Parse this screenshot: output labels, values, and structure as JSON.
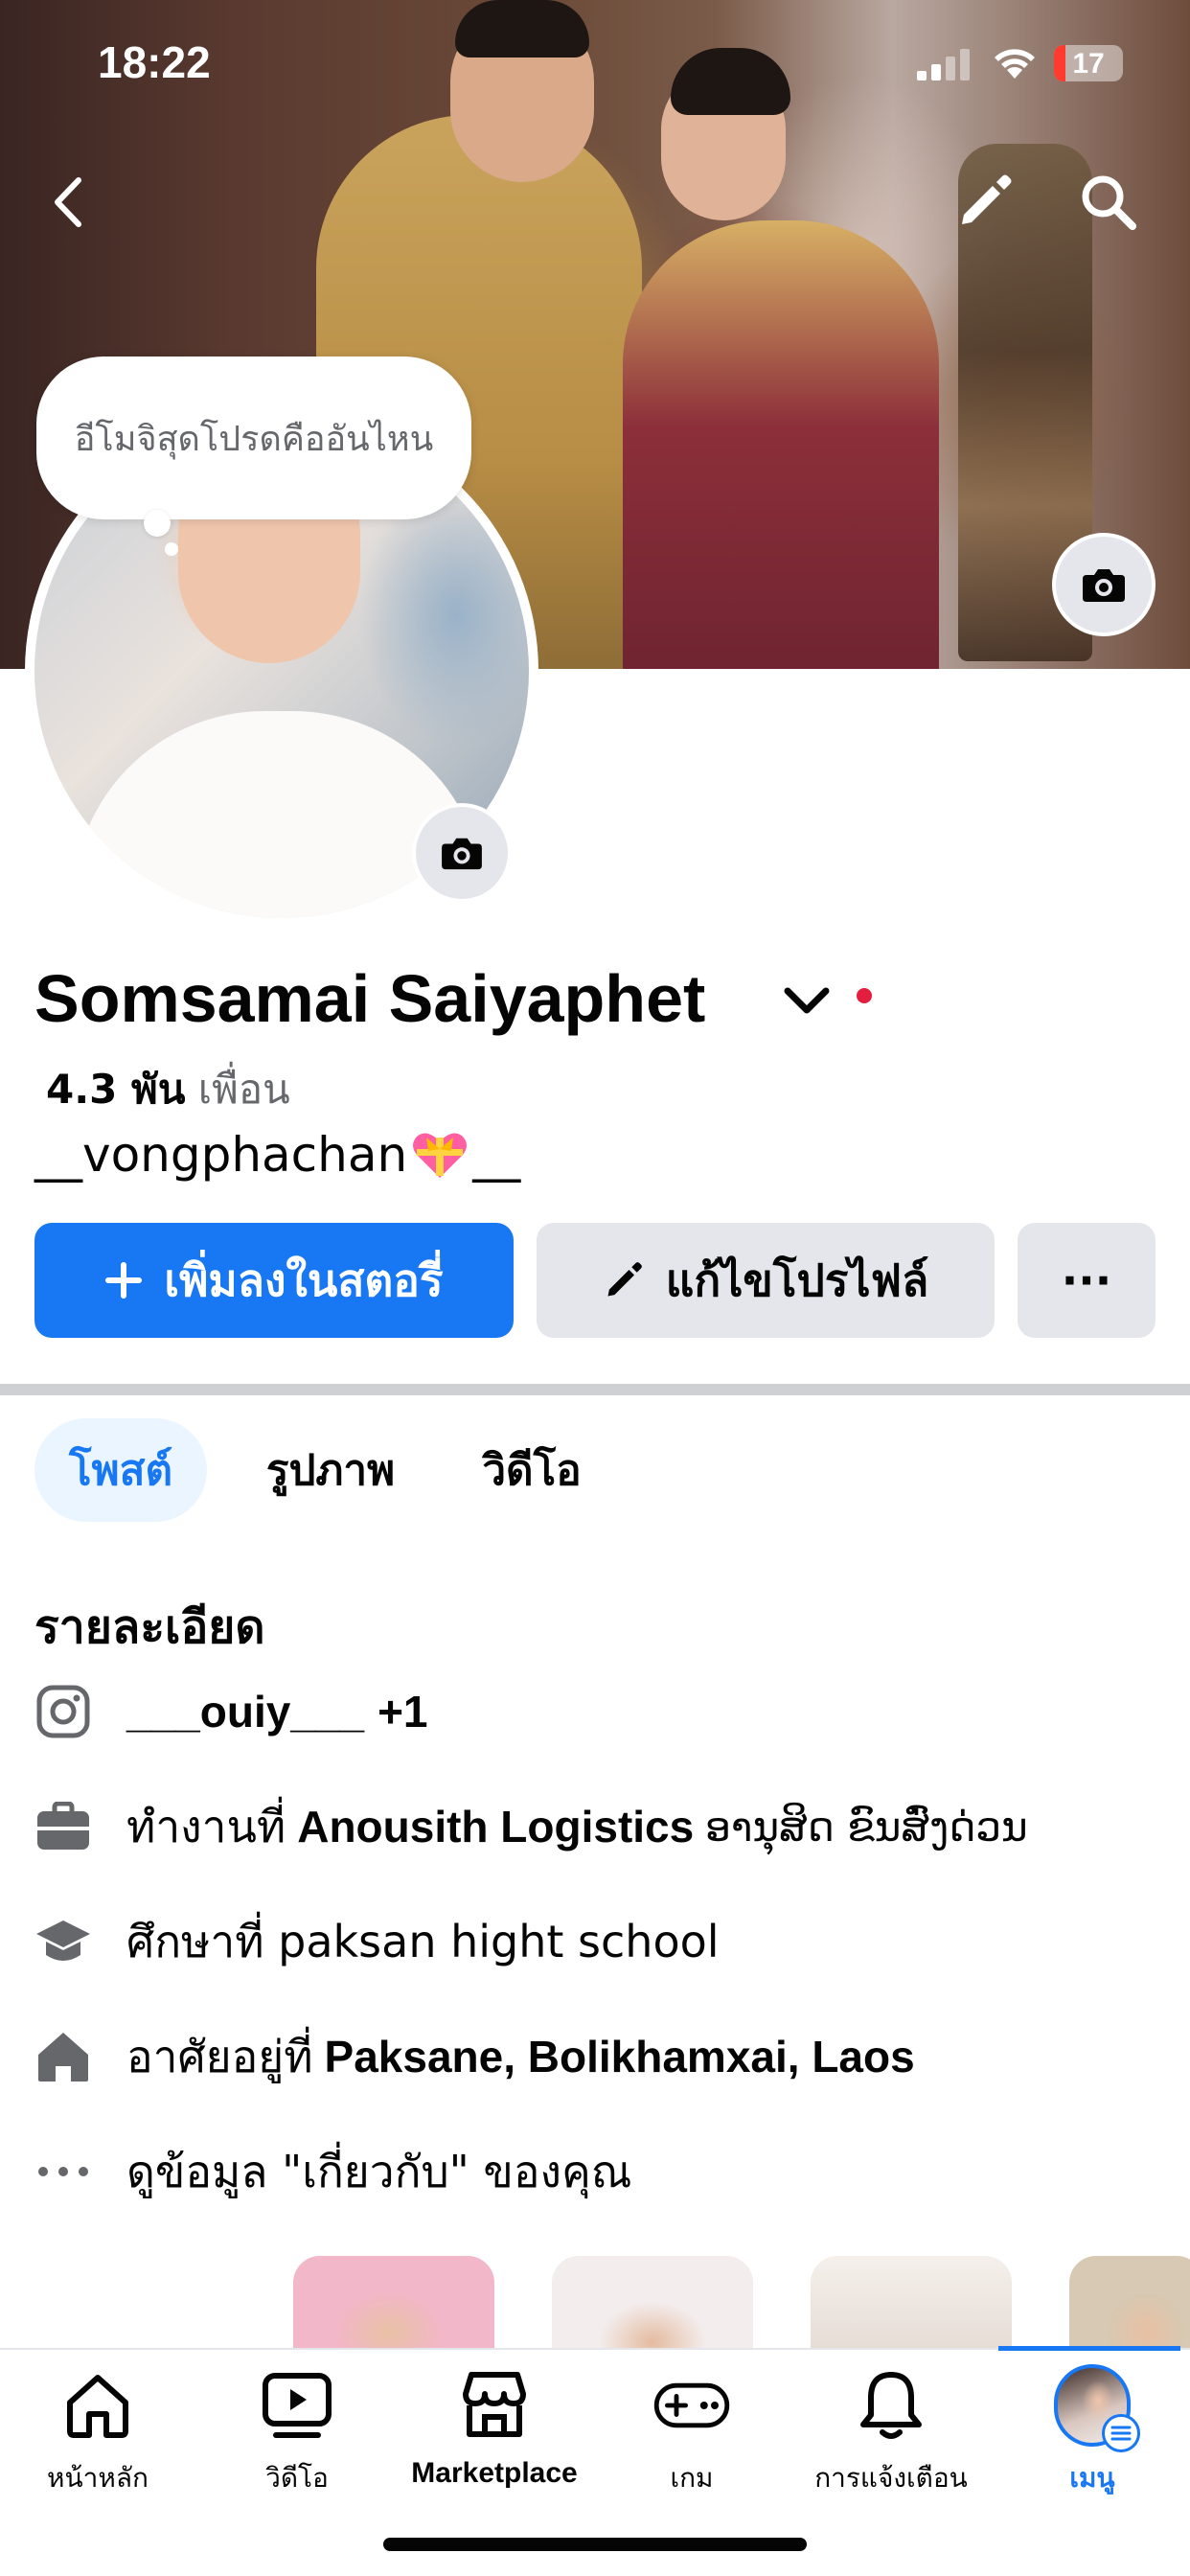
{
  "status_bar": {
    "time": "18:22",
    "battery": "17",
    "battery_level": 0.17
  },
  "cover": {
    "note": "อีโมจิสุดโปรดคืออันไหน"
  },
  "profile": {
    "name": "Somsamai Saiyaphet",
    "friends_count": "4.3 พัน",
    "friends_label": "เพื่อน",
    "bio_prefix": "__vongphachan",
    "bio_suffix": "__"
  },
  "actions": {
    "add_story": "เพิ่มลงในสตอรี่",
    "edit_profile": "แก้ไขโปรไฟล์",
    "more": "···"
  },
  "tabs": [
    {
      "label": "โพสต์",
      "active": true
    },
    {
      "label": "รูปภาพ",
      "active": false
    },
    {
      "label": "วิดีโอ",
      "active": false
    }
  ],
  "details": {
    "title": "รายละเอียด",
    "instagram": {
      "handle": "___ouiy___",
      "extra": "+1"
    },
    "work": {
      "prefix": "ทำงานที่",
      "company": "Anousith Logistics",
      "suffix": "ອານຸສິດ ຂົນສົ່ງດ່ວນ"
    },
    "school": {
      "text": "ศึกษาที่ paksan hight school"
    },
    "home": {
      "prefix": "อาศัยอยู่ที่",
      "place": "Paksane, Bolikhamxai, Laos"
    },
    "about": {
      "text": "ดูข้อมูล \"เกี่ยวกับ\" ของคุณ"
    }
  },
  "bottom_nav": [
    {
      "label": "หน้าหลัก",
      "icon": "home-icon"
    },
    {
      "label": "วิดีโอ",
      "icon": "video-icon"
    },
    {
      "label": "Marketplace",
      "icon": "marketplace-icon"
    },
    {
      "label": "เกม",
      "icon": "gamepad-icon"
    },
    {
      "label": "การแจ้งเตือน",
      "icon": "bell-icon"
    },
    {
      "label": "เมนู",
      "icon": "menu-avatar",
      "active": true
    }
  ],
  "colors": {
    "accent": "#1877f2",
    "secondary_button": "#e4e6eb",
    "text_secondary": "#65676b",
    "online_dot": "#e41e3f"
  }
}
